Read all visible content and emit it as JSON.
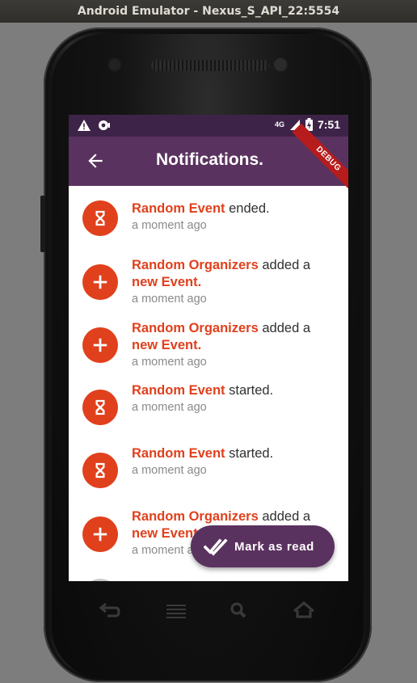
{
  "window": {
    "title": "Android Emulator - Nexus_S_API_22:5554"
  },
  "statusbar": {
    "network": "4G",
    "time": "7:51"
  },
  "appbar": {
    "title": "Notifications.",
    "debug_banner": "DEBUG"
  },
  "notifications": [
    {
      "icon": "hourglass-icon",
      "subject": "Random Event",
      "action": " ended.",
      "object": "",
      "time": "a moment ago"
    },
    {
      "icon": "plus-icon",
      "subject": "Random Organizers",
      "action": " added a ",
      "object": "new Event.",
      "time": "a moment ago"
    },
    {
      "icon": "plus-icon",
      "subject": "Random Organizers",
      "action": " added a ",
      "object": "new Event.",
      "time": "a moment ago"
    },
    {
      "icon": "hourglass-icon",
      "subject": "Random Event",
      "action": " started.",
      "object": "",
      "time": "a moment ago"
    },
    {
      "icon": "hourglass-icon",
      "subject": "Random Event",
      "action": " started.",
      "object": "",
      "time": "a moment ago"
    },
    {
      "icon": "plus-icon",
      "subject": "Random Organizers",
      "action": " added a ",
      "object": "new Event.",
      "time": "a moment ago"
    }
  ],
  "fab": {
    "label": "Mark as read",
    "icon": "double-check-icon"
  },
  "colors": {
    "appbar": "#5a325f",
    "statusbar": "#3e2348",
    "accent": "#e0401c"
  },
  "navbar": [
    "back-icon",
    "menu-icon",
    "search-icon",
    "home-icon"
  ]
}
